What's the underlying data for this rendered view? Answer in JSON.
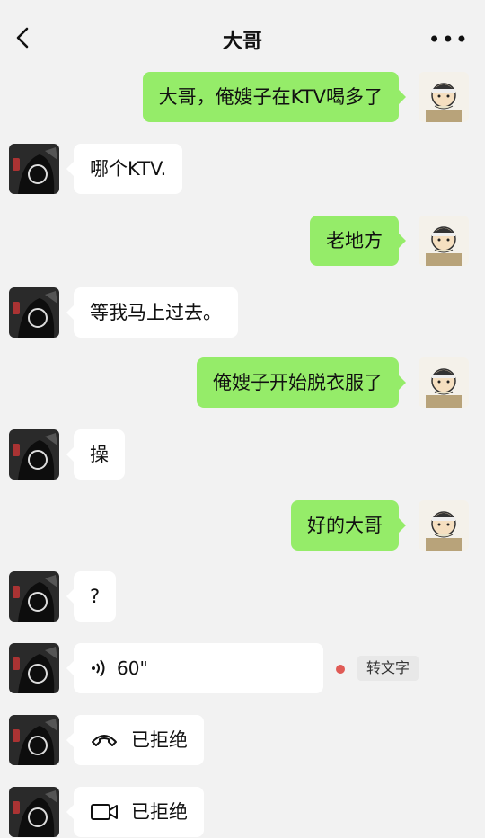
{
  "header": {
    "title": "大哥",
    "more": "•••"
  },
  "messages": [
    {
      "from": "me",
      "text": "大哥，俺嫂子在KTV喝多了"
    },
    {
      "from": "other",
      "text": "哪个KTV."
    },
    {
      "from": "me",
      "text": "老地方"
    },
    {
      "from": "other",
      "text": "等我马上过去。"
    },
    {
      "from": "me",
      "text": "俺嫂子开始脱衣服了"
    },
    {
      "from": "other",
      "text": "操"
    },
    {
      "from": "me",
      "text": "好的大哥"
    },
    {
      "from": "other",
      "text": "?"
    },
    {
      "from": "other",
      "type": "voice",
      "duration": "60\"",
      "action": "转文字"
    },
    {
      "from": "other",
      "type": "call",
      "icon": "phone-icon",
      "text": "已拒绝"
    },
    {
      "from": "other",
      "type": "call",
      "icon": "video-icon",
      "text": "已拒绝"
    }
  ],
  "colors": {
    "me_bubble": "#95ec69",
    "other_bubble": "#ffffff",
    "unread_dot": "#e05b56"
  }
}
